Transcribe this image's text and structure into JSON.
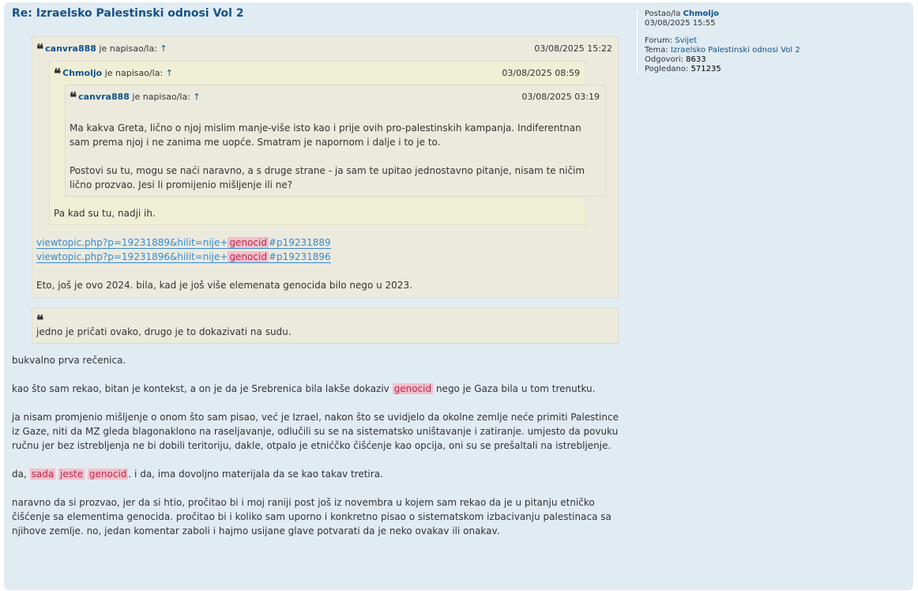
{
  "post": {
    "title": "Re: Izraelsko Palestinski odnosi Vol 2"
  },
  "profile": {
    "posted_by_label": "Postao/la",
    "author": "Chmoljo",
    "date": "03/08/2025 15:55",
    "forum_label": "Forum:",
    "forum": "Svijet",
    "topic_label": "Tema:",
    "topic": "Izraelsko Palestinski odnosi Vol 2",
    "replies_label": "Odgovori:",
    "replies": "8633",
    "views_label": "Pogledano:",
    "views": "571235"
  },
  "quote1": {
    "user": "canvra888",
    "wrote": "je napisao/la:",
    "arrow": "↑",
    "date": "03/08/2025 15:22",
    "links": [
      {
        "prefix": "viewtopic.php?p=19231889&hilit=nije+",
        "hl": "genocid",
        "suffix": "#p19231889"
      },
      {
        "prefix": "viewtopic.php?p=19231896&hilit=nije+",
        "hl": "genocid",
        "suffix": "#p19231896"
      }
    ],
    "text": "Eto, još je ovo 2024. bila, kad je još više elemenata genocida bilo nego u 2023."
  },
  "quote2": {
    "user": "Chmoljo",
    "wrote": "je napisao/la:",
    "arrow": "↑",
    "date": "03/08/2025 08:59",
    "text": "Pa kad su tu, nadji ih."
  },
  "quote3": {
    "user": "canvra888",
    "wrote": "je napisao/la:",
    "arrow": "↑",
    "date": "03/08/2025 03:19",
    "p1": "Ma kakva Greta, lično o njoj mislim manje-više isto kao i prije ovih pro-palestinskih kampanja. Indiferentnan sam prema njoj i ne zanima me uopće. Smatram je napornom i dalje i to je to.",
    "p2": "Postovi su tu, mogu se naći naravno, a s druge strane - ja sam te upitao jednostavno pitanje, nisam te ničim lično prozvao. Jesi li promijenio mišljenje ili ne?"
  },
  "quote4": {
    "text": "jedno je pričati ovako, drugo je to dokazivati na sudu."
  },
  "body": {
    "p1": "bukvalno prva rečenica.",
    "p2_a": "kao što sam rekao, bitan je kontekst, a on je da je Srebrenica bila lakše dokaziv",
    "p2_hl": "genocid",
    "p2_b": "nego je Gaza bila u tom trenutku.",
    "p3": "ja nisam promjenio mišljenje o onom što sam pisao, već je Izrael, nakon što se uvidjelo da okolne zemlje neće primiti Palestince iz Gaze, niti da MZ gleda blagonaklono na raseljavanje, odlučili su se na sistematsko uništavanje i zatiranje. umjesto da povuku ručnu jer bez istrebljenja ne bi dobili teritoriju, dakle, otpalo je etnićčko čišćenje kao opcija, oni su se prešaltali na istrebljenje.",
    "p4_a": "da,",
    "p4_hl1": "sada",
    "p4_hl2": "jeste",
    "p4_hl3": "genocid",
    "p4_b": ". i da, ima dovoljno materijala da se kao takav tretira.",
    "p5": "naravno da si prozvao, jer da si htio, pročitao bi i moj raniji post još iz novembra u kojem sam rekao da je u pitanju etničko čišćenje sa elementima genocida. pročitao bi i koliko sam uporno i konkretno pisao o sistematskom izbacivanju palestinaca sa njihove zemlje. no, jedan komentar zaboli i hajmo usijane glave potvarati da je neko ovakav ili onakav."
  },
  "icons": {
    "quote": "quote-icon"
  },
  "colors": {
    "link": "#105289",
    "highlight_bg": "#f3bfcc",
    "quote_bg": "#ebeadd",
    "post_bg": "#e1ebf2"
  }
}
